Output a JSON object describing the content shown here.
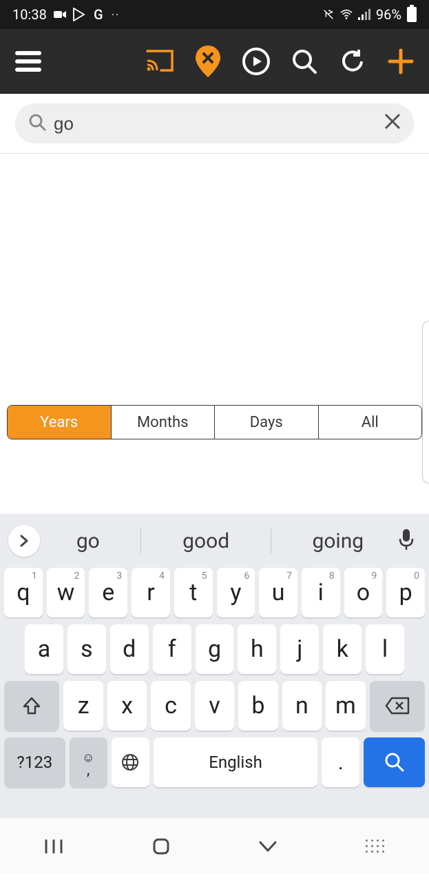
{
  "status": {
    "time": "10:38",
    "battery_pct": "96%"
  },
  "search": {
    "value": "go"
  },
  "segments": {
    "years": "Years",
    "months": "Months",
    "days": "Days",
    "all": "All"
  },
  "suggestions": {
    "w1": "go",
    "w2": "good",
    "w3": "going"
  },
  "keys": {
    "row1": [
      "q",
      "w",
      "e",
      "r",
      "t",
      "y",
      "u",
      "i",
      "o",
      "p"
    ],
    "row1_sup": [
      "1",
      "2",
      "3",
      "4",
      "5",
      "6",
      "7",
      "8",
      "9",
      "0"
    ],
    "row2": [
      "a",
      "s",
      "d",
      "f",
      "g",
      "h",
      "j",
      "k",
      "l"
    ],
    "row3": [
      "z",
      "x",
      "c",
      "v",
      "b",
      "n",
      "m"
    ],
    "sym": "?123",
    "comma": ",",
    "space": "English",
    "dot": "."
  }
}
